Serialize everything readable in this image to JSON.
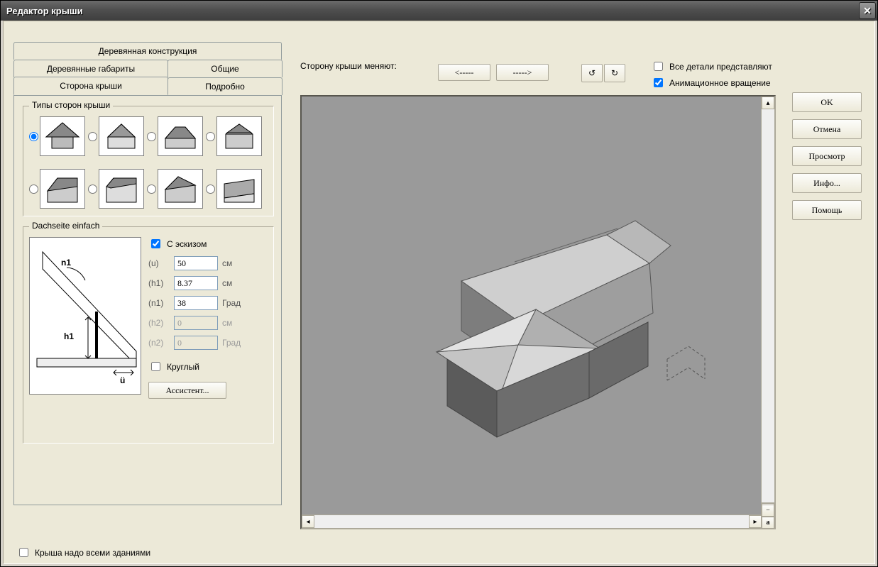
{
  "window": {
    "title": "Редактор крыши"
  },
  "tabs": {
    "wood_construction": "Деревянная конструкция",
    "wood_dims": "Деревянные габариты",
    "general": "Общие",
    "roof_side": "Сторона крыши",
    "detailed": "Подробно"
  },
  "groups": {
    "roof_types": "Типы сторон крыши",
    "simple_side": "Dachseite einfach"
  },
  "simple": {
    "with_sketch": "С эскизом",
    "u_label": "(u)",
    "u_value": "50",
    "u_unit": "см",
    "h1_label": "(h1)",
    "h1_value": "8.37",
    "h1_unit": "см",
    "n1_label": "(n1)",
    "n1_value": "38",
    "n1_unit": "Град",
    "h2_label": "(h2)",
    "h2_value": "0",
    "h2_unit": "см",
    "n2_label": "(n2)",
    "n2_value": "0",
    "n2_unit": "Град",
    "round": "Круглый",
    "assistant": "Ассистент...",
    "sketch_n1": "n1",
    "sketch_h1": "h1",
    "sketch_u": "ü"
  },
  "right_side": {
    "label": "Сторону крыши меняют:",
    "prev": "<-----",
    "next": "----->",
    "show_all": "Все детали представляют",
    "anim_rot": "Анимационное вращение"
  },
  "viewport_controls": {
    "plus": "+",
    "minus": "−",
    "all": "a"
  },
  "actions": {
    "ok": "OK",
    "cancel": "Отмена",
    "preview": "Просмотр",
    "info": "Инфо...",
    "help": "Помощь"
  },
  "bottom": {
    "roof_over_all": "Крыша надо всеми зданиями"
  }
}
